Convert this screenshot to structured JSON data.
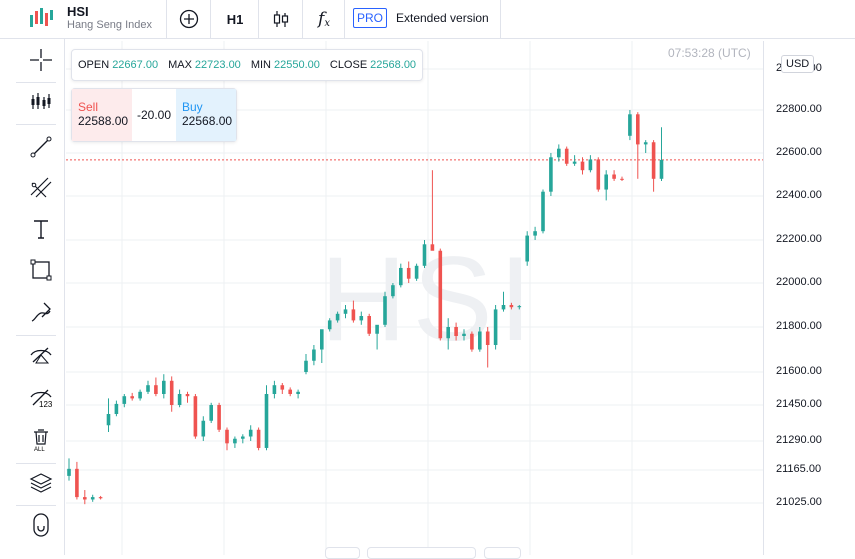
{
  "header": {
    "symbol": "HSI",
    "description": "Hang Seng Index",
    "interval": "H1",
    "fx_icon_label": "f",
    "pro_badge": "PRO",
    "extended_label": "Extended version"
  },
  "quote": {
    "open_label": "OPEN",
    "open": "22667.00",
    "max_label": "MAX",
    "max": "22723.00",
    "min_label": "MIN",
    "min": "22550.00",
    "close_label": "CLOSE",
    "close": "22568.00"
  },
  "trade": {
    "sell_label": "Sell",
    "sell_price": "22588.00",
    "spread": "-20.00",
    "buy_label": "Buy",
    "buy_price": "22568.00"
  },
  "clock": "07:53:28 (UTC)",
  "currency": "USD",
  "watermark": "HSI",
  "price_axis": [
    "23000.00",
    "22800.00",
    "22600.00",
    "22400.00",
    "22200.00",
    "22000.00",
    "21800.00",
    "21600.00",
    "21450.00",
    "21290.00",
    "21165.00",
    "21025.00"
  ],
  "colors": {
    "up": "#26a69a",
    "down": "#ef5350",
    "accent": "#2962ff"
  },
  "toolbar_icons": [
    "crosshair-icon",
    "indicators-icon",
    "trendline-icon",
    "fib-icon",
    "text-icon",
    "rectangle-icon",
    "brush-icon",
    "hide-drawings-icon",
    "hide-labels-icon",
    "remove-all-icon",
    "layers-icon",
    "magnet-icon"
  ],
  "chart_data": {
    "type": "candlestick",
    "symbol": "HSI",
    "interval": "H1",
    "price_axis_ticks": [
      23000,
      22800,
      22600,
      22400,
      22200,
      22000,
      21800,
      21600,
      21450,
      21290,
      21165,
      21025
    ],
    "current_price": 22568,
    "candles": [
      [
        21140,
        21215,
        21120,
        21170
      ],
      [
        21170,
        21200,
        21040,
        21050
      ],
      [
        21050,
        21080,
        21020,
        21040
      ],
      [
        21040,
        21060,
        21030,
        21050
      ],
      [
        21050,
        21055,
        21040,
        21045
      ],
      [
        21360,
        21480,
        21330,
        21410
      ],
      [
        21410,
        21470,
        21400,
        21455
      ],
      [
        21455,
        21500,
        21440,
        21490
      ],
      [
        21490,
        21505,
        21470,
        21480
      ],
      [
        21480,
        21520,
        21470,
        21510
      ],
      [
        21510,
        21560,
        21500,
        21540
      ],
      [
        21540,
        21575,
        21490,
        21500
      ],
      [
        21500,
        21590,
        21480,
        21560
      ],
      [
        21560,
        21580,
        21420,
        21450
      ],
      [
        21450,
        21520,
        21440,
        21500
      ],
      [
        21500,
        21510,
        21460,
        21490
      ],
      [
        21490,
        21500,
        21300,
        21310
      ],
      [
        21310,
        21400,
        21290,
        21380
      ],
      [
        21380,
        21460,
        21370,
        21450
      ],
      [
        21450,
        21460,
        21330,
        21340
      ],
      [
        21340,
        21350,
        21250,
        21280
      ],
      [
        21280,
        21310,
        21260,
        21300
      ],
      [
        21300,
        21320,
        21280,
        21310
      ],
      [
        21310,
        21360,
        21290,
        21340
      ],
      [
        21340,
        21350,
        21250,
        21260
      ],
      [
        21260,
        21540,
        21250,
        21500
      ],
      [
        21500,
        21560,
        21480,
        21540
      ],
      [
        21540,
        21550,
        21500,
        21520
      ],
      [
        21520,
        21530,
        21490,
        21500
      ],
      [
        21500,
        21520,
        21480,
        21510
      ],
      [
        21600,
        21680,
        21590,
        21650
      ],
      [
        21650,
        21720,
        21630,
        21700
      ],
      [
        21700,
        21780,
        21640,
        21790
      ],
      [
        21790,
        21840,
        21780,
        21830
      ],
      [
        21830,
        21870,
        21820,
        21860
      ],
      [
        21860,
        21900,
        21840,
        21880
      ],
      [
        21880,
        21920,
        21820,
        21830
      ],
      [
        21830,
        21870,
        21810,
        21850
      ],
      [
        21850,
        21860,
        21760,
        21770
      ],
      [
        21770,
        21780,
        21700,
        21810
      ],
      [
        21810,
        21960,
        21800,
        21940
      ],
      [
        21940,
        22000,
        21930,
        21990
      ],
      [
        21990,
        22090,
        21980,
        22070
      ],
      [
        22070,
        22100,
        22000,
        22020
      ],
      [
        22020,
        22090,
        22010,
        22080
      ],
      [
        22080,
        22200,
        22070,
        22180
      ],
      [
        22180,
        22520,
        22160,
        22150
      ],
      [
        22150,
        22160,
        21740,
        21750
      ],
      [
        21750,
        21840,
        21700,
        21800
      ],
      [
        21800,
        21820,
        21740,
        21760
      ],
      [
        21760,
        21790,
        21740,
        21770
      ],
      [
        21770,
        21780,
        21690,
        21700
      ],
      [
        21700,
        21800,
        21690,
        21780
      ],
      [
        21780,
        21800,
        21620,
        21720
      ],
      [
        21720,
        21900,
        21700,
        21880
      ],
      [
        21880,
        21960,
        21870,
        21900
      ],
      [
        21900,
        21910,
        21880,
        21890
      ],
      [
        21890,
        21900,
        21880,
        21895
      ],
      [
        22100,
        22240,
        22080,
        22220
      ],
      [
        22220,
        22260,
        22200,
        22240
      ],
      [
        22240,
        22430,
        22230,
        22420
      ],
      [
        22420,
        22600,
        22400,
        22580
      ],
      [
        22580,
        22640,
        22560,
        22620
      ],
      [
        22620,
        22630,
        22540,
        22550
      ],
      [
        22550,
        22590,
        22540,
        22560
      ],
      [
        22560,
        22580,
        22500,
        22520
      ],
      [
        22520,
        22590,
        22510,
        22570
      ],
      [
        22570,
        22580,
        22420,
        22430
      ],
      [
        22430,
        22520,
        22380,
        22500
      ],
      [
        22500,
        22520,
        22470,
        22480
      ],
      [
        22480,
        22490,
        22470,
        22475
      ],
      [
        22680,
        22800,
        22660,
        22780
      ],
      [
        22780,
        22790,
        22480,
        22640
      ],
      [
        22640,
        22660,
        22600,
        22650
      ],
      [
        22650,
        22660,
        22420,
        22480
      ],
      [
        22480,
        22720,
        22470,
        22568
      ]
    ]
  }
}
